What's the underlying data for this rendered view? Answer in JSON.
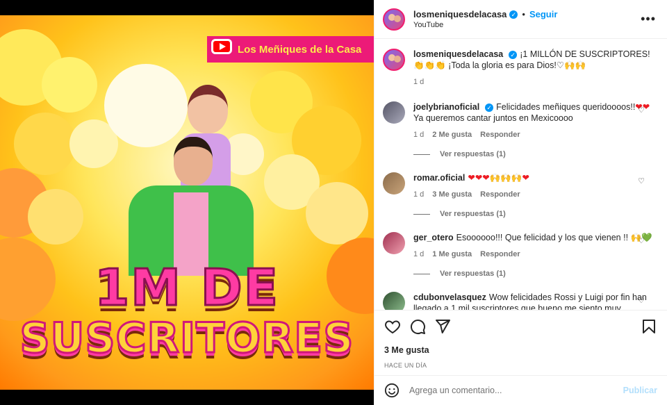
{
  "post": {
    "image": {
      "channel_banner": "Los Meñiques de la Casa",
      "headline_1": "1M DE",
      "headline_2": "SUSCRITORES"
    },
    "header": {
      "username": "losmeniquesdelacasa",
      "follow_label": "Seguir",
      "subtitle": "YouTube",
      "separator": "•"
    },
    "caption": {
      "username": "losmeniquesdelacasa",
      "text": "¡1 MILLÓN DE SUSCRIPTORES!👏👏👏 ¡Toda la gloria es para Dios!♡🙌🙌",
      "time": "1 d"
    },
    "comments": [
      {
        "username": "joelybrianoficial",
        "verified": true,
        "text": "Felicidades meñiques queridoooos!!",
        "text_line2": "Ya queremos cantar juntos en Mexicoooo",
        "emoji": "❤❤",
        "time": "1 d",
        "likes": "2 Me gusta",
        "reply": "Responder",
        "view_replies": "Ver respuestas (1)"
      },
      {
        "username": "romar.oficial",
        "verified": false,
        "text": "",
        "emoji": "❤❤❤🙌🙌🙌❤",
        "time": "1 d",
        "likes": "3 Me gusta",
        "reply": "Responder",
        "view_replies": "Ver respuestas (1)"
      },
      {
        "username": "ger_otero",
        "verified": false,
        "text": "Esoooooo!!! Que felicidad y los que vienen !!",
        "emoji": "🙌💚",
        "time": "1 d",
        "likes": "1 Me gusta",
        "reply": "Responder",
        "view_replies": "Ver respuestas (1)"
      },
      {
        "username": "cdubonvelasquez",
        "verified": false,
        "text": "Wow felicidades Rossi y Luigi por fin han llegado a 1 mil suscriptores que bueno me siento muy"
      }
    ],
    "likes": "3 Me gusta",
    "posted": "HACE UN DÍA",
    "add_comment": {
      "placeholder": "Agrega un comentario...",
      "publish": "Publicar"
    },
    "icons": [
      "heart-outline-icon",
      "comment-icon",
      "share-icon",
      "bookmark-icon",
      "emoji-icon",
      "more-icon",
      "verified-badge-icon"
    ],
    "colors": {
      "accent": "#0095f6",
      "banner_pink": "#ec1a78",
      "heart_red": "#ed1c24"
    }
  }
}
